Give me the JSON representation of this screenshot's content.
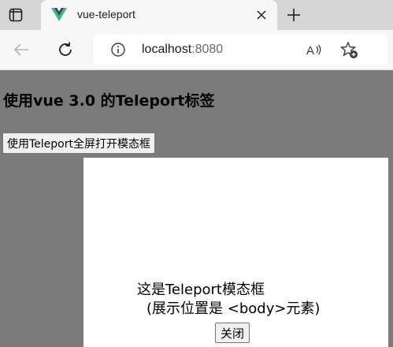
{
  "browser": {
    "tab": {
      "title": "vue-teleport"
    },
    "address": {
      "host": "localhost",
      "port": ":8080"
    }
  },
  "page": {
    "title": "使用vue 3.0 的Teleport标签",
    "open_button_label": "使用Teleport全屏打开模态框",
    "modal": {
      "line1": "这是Teleport模态框",
      "line2": "(展示位置是 <body>元素)",
      "close_label": "关闭"
    }
  },
  "colors": {
    "overlay": "#7b7b7b",
    "vue_green": "#41b883",
    "vue_dark": "#35495e"
  },
  "icons": [
    "tab-actions-icon",
    "vue-logo-icon",
    "close-icon",
    "plus-icon",
    "back-arrow-icon",
    "reload-icon",
    "info-icon",
    "read-aloud-icon",
    "add-favorite-icon"
  ]
}
